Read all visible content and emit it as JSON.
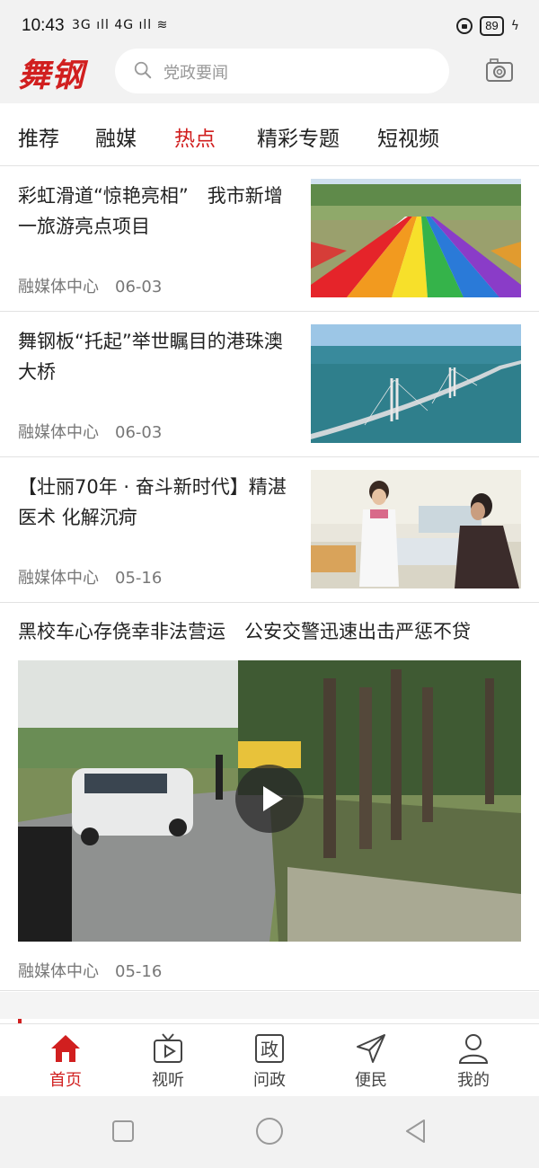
{
  "status": {
    "time": "10:43",
    "signal": "3G ıll 4G ıll ≋",
    "battery": "89"
  },
  "header": {
    "logo": "舞钢",
    "search_placeholder": "党政要闻",
    "icons": [
      "search-icon",
      "camera-icon"
    ]
  },
  "tabs": [
    {
      "label": "推荐",
      "active": false
    },
    {
      "label": "融媒",
      "active": false
    },
    {
      "label": "热点",
      "active": true
    },
    {
      "label": "精彩专题",
      "active": false
    },
    {
      "label": "短视频",
      "active": false
    }
  ],
  "news": [
    {
      "title": "彩虹滑道“惊艳亮相”　我市新增一旅游亮点项目",
      "source": "融媒体中心",
      "date": "06-03",
      "image": "rainbow-slide-photo"
    },
    {
      "title": "舞钢板“托起”举世瞩目的港珠澳大桥",
      "source": "融媒体中心",
      "date": "06-03",
      "image": "bridge-photo"
    },
    {
      "title": "【壮丽70年 · 奋斗新时代】精湛医术 化解沉疴",
      "source": "融媒体中心",
      "date": "05-16",
      "image": "hospital-photo"
    }
  ],
  "video": {
    "title": "黑校车心存侥幸非法营运　公安交警迅速出击严惩不贷",
    "source": "融媒体中心",
    "date": "05-16",
    "image": "roadside-video-frame"
  },
  "bottom_nav": [
    {
      "label": "首页",
      "icon": "home-icon",
      "active": true
    },
    {
      "label": "视听",
      "icon": "tv-icon",
      "active": false
    },
    {
      "label": "问政",
      "icon": "zheng-icon",
      "active": false
    },
    {
      "label": "便民",
      "icon": "paper-plane-icon",
      "active": false
    },
    {
      "label": "我的",
      "icon": "user-icon",
      "active": false
    }
  ],
  "colors": {
    "accent": "#d11f1f",
    "text": "#222222",
    "meta": "#777777",
    "background": "#f2f2f2"
  }
}
